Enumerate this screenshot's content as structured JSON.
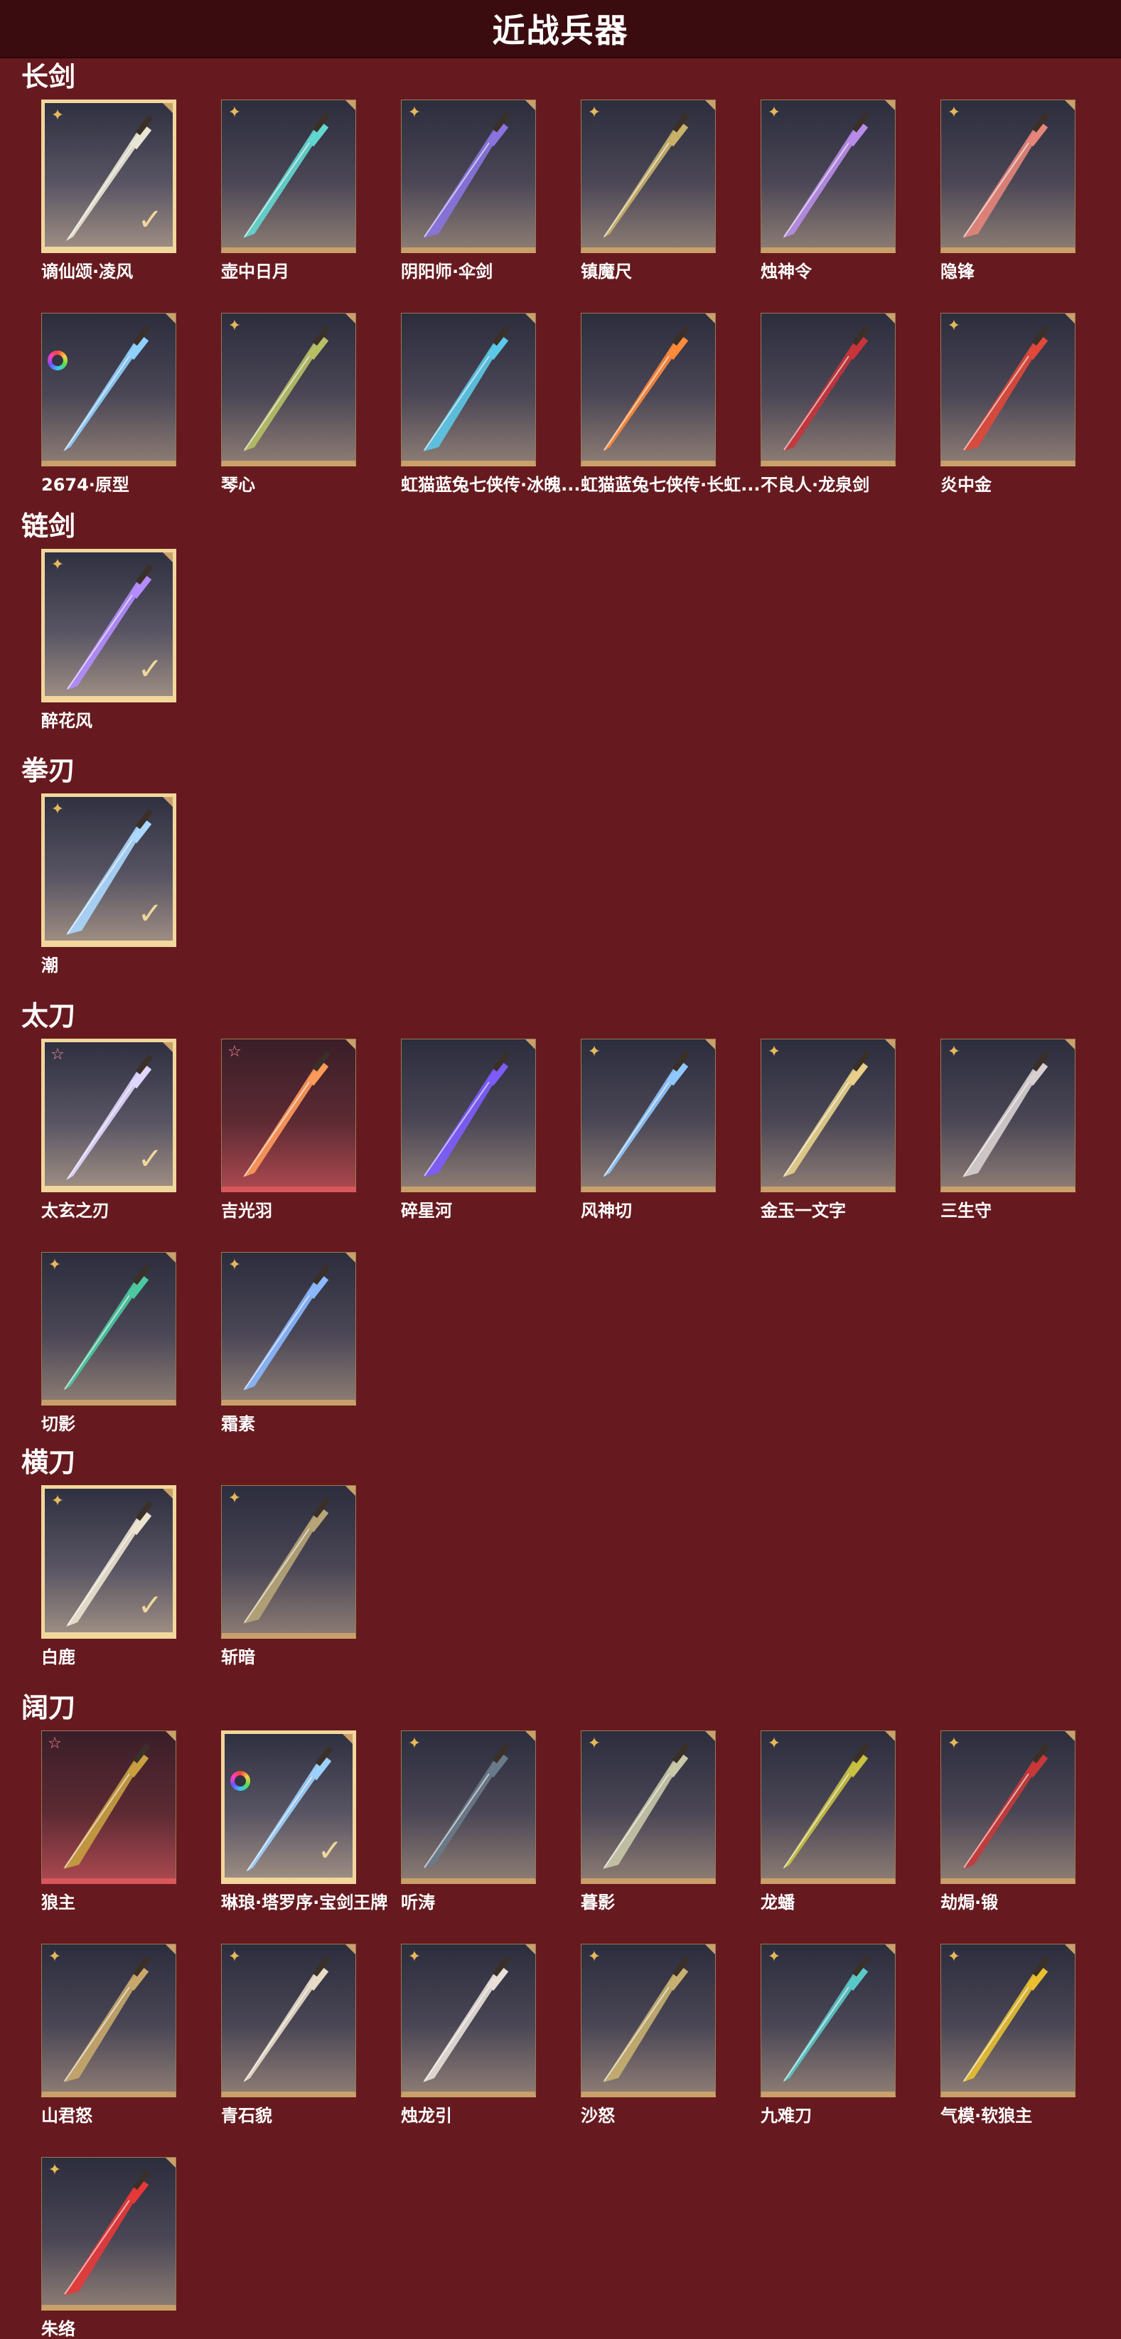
{
  "header": {
    "title": "近战兵器"
  },
  "colors": {
    "background": "#661a1f",
    "header": "#3a0c10",
    "gold": "#c9a06a",
    "selected": "#f1d79c"
  },
  "sections": [
    {
      "title": "长剑",
      "items": [
        {
          "name": "谪仙颂·凌风",
          "rank": "gold",
          "selected": true,
          "weapon_color": "#e9e5d4"
        },
        {
          "name": "壶中日月",
          "rank": "gold",
          "selected": false,
          "weapon_color": "#62d7cf"
        },
        {
          "name": "阴阳师·伞剑",
          "rank": "gold",
          "selected": false,
          "weapon_color": "#8a74e0"
        },
        {
          "name": "镇魔尺",
          "rank": "gold",
          "selected": false,
          "weapon_color": "#c9b16a"
        },
        {
          "name": "烛神令",
          "rank": "gold",
          "selected": false,
          "weapon_color": "#b88ce8"
        },
        {
          "name": "隐锋",
          "rank": "gold",
          "selected": false,
          "weapon_color": "#e6857a"
        },
        {
          "name": "2674·原型",
          "rank": "color",
          "selected": false,
          "weapon_color": "#8ed0ff"
        },
        {
          "name": "琴心",
          "rank": "gold",
          "selected": false,
          "weapon_color": "#b7c065"
        },
        {
          "name": "虹猫蓝兔七侠传·冰魄...",
          "rank": "none",
          "selected": false,
          "weapon_color": "#5cc8e8"
        },
        {
          "name": "虹猫蓝兔七侠传·长虹...",
          "rank": "none",
          "selected": false,
          "weapon_color": "#ff8a3a"
        },
        {
          "name": "不良人·龙泉剑",
          "rank": "none",
          "selected": false,
          "weapon_color": "#c8343a"
        },
        {
          "name": "炎中金",
          "rank": "gold",
          "selected": false,
          "weapon_color": "#e0483a"
        }
      ]
    },
    {
      "title": "链剑",
      "items": [
        {
          "name": "醉花风",
          "rank": "gold",
          "selected": true,
          "weapon_color": "#b48cff"
        }
      ]
    },
    {
      "title": "拳刃",
      "items": [
        {
          "name": "潮",
          "rank": "gold",
          "selected": true,
          "weapon_color": "#aad8ff"
        }
      ]
    },
    {
      "title": "太刀",
      "items": [
        {
          "name": "太玄之刃",
          "rank": "red",
          "selected": true,
          "weapon_color": "#e0d6ff"
        },
        {
          "name": "吉光羽",
          "rank": "red",
          "selected": false,
          "red": true,
          "weapon_color": "#ff9a5a"
        },
        {
          "name": "碎星河",
          "rank": "none",
          "selected": false,
          "weapon_color": "#7d5cff"
        },
        {
          "name": "风神切",
          "rank": "gold",
          "selected": false,
          "weapon_color": "#8fc8ff"
        },
        {
          "name": "金玉一文字",
          "rank": "gold",
          "selected": false,
          "weapon_color": "#e8d08a"
        },
        {
          "name": "三生守",
          "rank": "gold",
          "selected": false,
          "weapon_color": "#d8d0d0"
        },
        {
          "name": "切影",
          "rank": "gold",
          "selected": false,
          "weapon_color": "#4ac8a0"
        },
        {
          "name": "霜素",
          "rank": "gold",
          "selected": false,
          "weapon_color": "#8ab8ff"
        }
      ]
    },
    {
      "title": "横刀",
      "items": [
        {
          "name": "白鹿",
          "rank": "gold",
          "selected": true,
          "weapon_color": "#ece4cf"
        },
        {
          "name": "斩暗",
          "rank": "gold",
          "selected": false,
          "weapon_color": "#b7a577"
        }
      ]
    },
    {
      "title": "阔刀",
      "items": [
        {
          "name": "狼主",
          "rank": "red",
          "selected": false,
          "red": true,
          "weapon_color": "#c8a040"
        },
        {
          "name": "琳琅·塔罗序·宝剑王牌",
          "rank": "color",
          "selected": true,
          "weapon_color": "#9cd0ff"
        },
        {
          "name": "听涛",
          "rank": "gold",
          "selected": false,
          "weapon_color": "#6a7a8a"
        },
        {
          "name": "暮影",
          "rank": "gold",
          "selected": false,
          "weapon_color": "#c8c8a8"
        },
        {
          "name": "龙蟠",
          "rank": "gold",
          "selected": false,
          "weapon_color": "#c8c040"
        },
        {
          "name": "劫焗·锻",
          "rank": "gold",
          "selected": false,
          "weapon_color": "#c83838"
        },
        {
          "name": "山君怒",
          "rank": "gold",
          "selected": false,
          "weapon_color": "#c8a86a"
        },
        {
          "name": "青石貌",
          "rank": "gold",
          "selected": false,
          "weapon_color": "#e8dcc8"
        },
        {
          "name": "烛龙引",
          "rank": "gold",
          "selected": false,
          "weapon_color": "#e8e0d8"
        },
        {
          "name": "沙怒",
          "rank": "gold",
          "selected": false,
          "weapon_color": "#c8b070"
        },
        {
          "name": "九难刀",
          "rank": "gold",
          "selected": false,
          "weapon_color": "#5ac8c8"
        },
        {
          "name": "气模·软狼主",
          "rank": "gold",
          "selected": false,
          "weapon_color": "#e8c030"
        },
        {
          "name": "朱络",
          "rank": "gold",
          "selected": false,
          "weapon_color": "#e83838"
        }
      ]
    }
  ]
}
